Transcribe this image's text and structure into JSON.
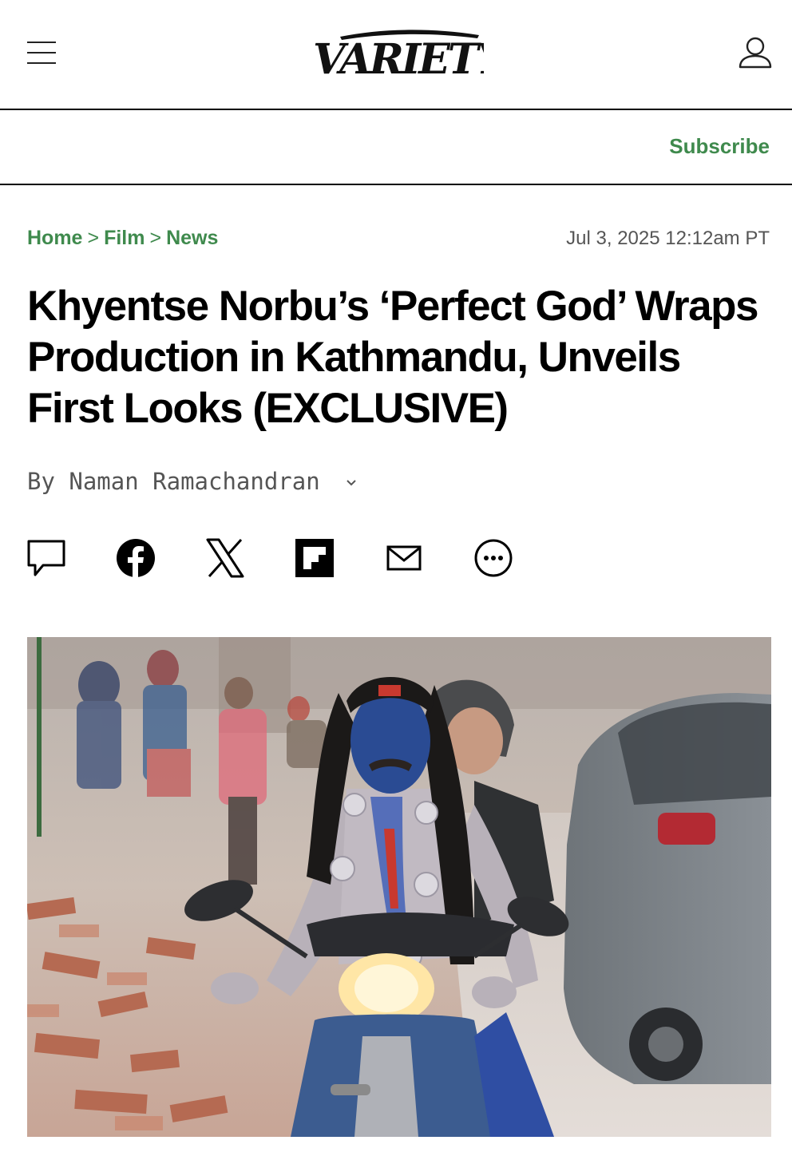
{
  "header": {
    "menu_icon": "hamburger-menu-icon",
    "logo_text": "VARIETY",
    "account_icon": "user-account-icon"
  },
  "subscribe_label": "Subscribe",
  "breadcrumb": [
    {
      "label": "Home"
    },
    {
      "label": "Film"
    },
    {
      "label": "News"
    }
  ],
  "breadcrumb_separator": ">",
  "date": "Jul 3, 2025 12:12am PT",
  "headline": "Khyentse Norbu’s ‘Perfect God’ Wraps Production in Kathmandu, Unveils First Looks (EXCLUSIVE)",
  "byline": {
    "prefix": "By",
    "author": "Naman Ramachandran"
  },
  "share_icons": [
    "comment-icon",
    "facebook-icon",
    "x-icon",
    "flipboard-icon",
    "email-icon",
    "more-icon"
  ],
  "colors": {
    "accent_green": "#3f8a4d",
    "text": "#000000",
    "muted": "#555555"
  }
}
